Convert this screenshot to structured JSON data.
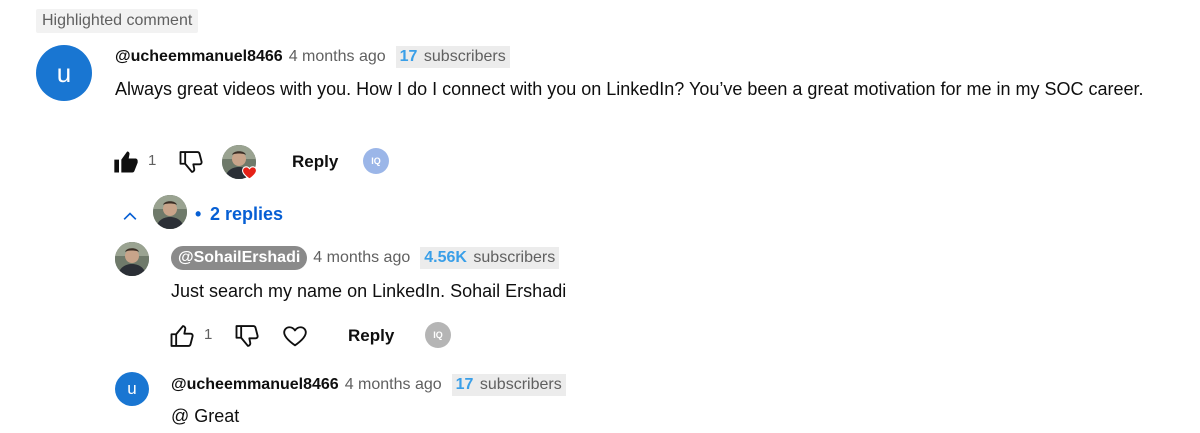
{
  "highlighted_label": "Highlighted comment",
  "comment": {
    "avatar_letter": "u",
    "author": "@ucheemmanuel8466",
    "time": "4 months ago",
    "subs_count": "17",
    "subs_label": "subscribers",
    "text": "Always great videos with you. How I do I connect with you on LinkedIn? You’ve been a great motivation for me in my SOC career.",
    "like_count": "1",
    "reply_label": "Reply",
    "iq_label": "IQ"
  },
  "replies_toggle": {
    "dot": "•",
    "label": "2 replies"
  },
  "replies": [
    {
      "author": "@SohailErshadi",
      "time": "4 months ago",
      "subs_count": "4.56K",
      "subs_label": "subscribers",
      "text": "Just search my name on LinkedIn. Sohail Ershadi",
      "like_count": "1",
      "reply_label": "Reply",
      "iq_label": "IQ"
    },
    {
      "avatar_letter": "u",
      "author": "@ucheemmanuel8466",
      "time": "4 months ago",
      "subs_count": "17",
      "subs_label": "subscribers",
      "text": "@ Great"
    }
  ],
  "colors": {
    "avatar_blue": "#1976d2",
    "link_blue": "#065fd4",
    "subs_blue": "#3a9fe8",
    "heart_red": "#e62117"
  }
}
